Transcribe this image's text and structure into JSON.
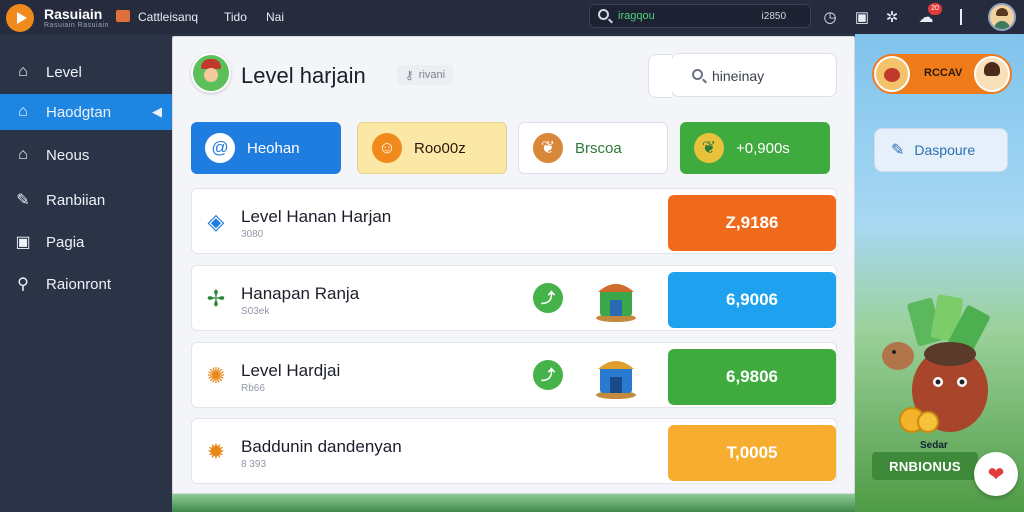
{
  "topbar": {
    "brand": "Rasuiain",
    "brand_sub": "Rasuiain Rasuiain",
    "nav": [
      "Cattleisanq",
      "Tido",
      "Nai"
    ],
    "search_value": "iragqou",
    "search_right": "i2850",
    "icons": [
      "clock-icon",
      "square-icon",
      "star-icon",
      "chat-icon"
    ],
    "badge": "20"
  },
  "sidebar": {
    "items": [
      {
        "label": "Level",
        "icon": "home-icon"
      },
      {
        "label": "Haodgtan",
        "icon": "home-icon",
        "active": true
      },
      {
        "label": "Neous",
        "icon": "home-icon"
      },
      {
        "label": "Ranbiian",
        "icon": "pen-icon"
      },
      {
        "label": "Pagia",
        "icon": "square-icon"
      },
      {
        "label": "Raionront",
        "icon": "pin-icon"
      }
    ]
  },
  "panel": {
    "title": "Level harjain",
    "chip": "rivani",
    "search_value": "hineinay",
    "categories": [
      {
        "label": "Heohan",
        "bg": "#1f7de0",
        "color": "#ffffff",
        "icon": "swirl-icon"
      },
      {
        "label": "Roo00z",
        "bg": "#fbe7a6",
        "color": "#2a1a0a",
        "icon": "character-icon"
      },
      {
        "label": "Brscoa",
        "bg": "#ffffff",
        "color": "#2a7a3a",
        "icon": "leaf-icon"
      },
      {
        "label": "+0,900s",
        "bg": "#3fab3e",
        "color": "#ffffff",
        "icon": "leaf-icon"
      }
    ],
    "rows": [
      {
        "title": "Level Hanan Harjan",
        "sub": "3080",
        "value": "Z,9186",
        "color": "#ef6a1a",
        "icon": "cube-icon",
        "extras": false
      },
      {
        "title": "Hanapan Ranja",
        "sub": "S03ek",
        "value": "6,9006",
        "color": "#1ea2ef",
        "icon": "plant-icon",
        "extras": true
      },
      {
        "title": "Level Hardjai",
        "sub": "Rb66",
        "value": "6,9806",
        "color": "#3fab3e",
        "icon": "sun-icon",
        "extras": true
      },
      {
        "title": "Baddunin dandenyan",
        "sub": "8 393",
        "value": "T,0005",
        "color": "#f7ad2f",
        "icon": "sun-icon",
        "extras": false
      }
    ]
  },
  "right": {
    "profile_text": "RCCAV",
    "action_label": "Daspoure",
    "promo_small": "Sedar",
    "promo_big": "RNBIONUS"
  }
}
